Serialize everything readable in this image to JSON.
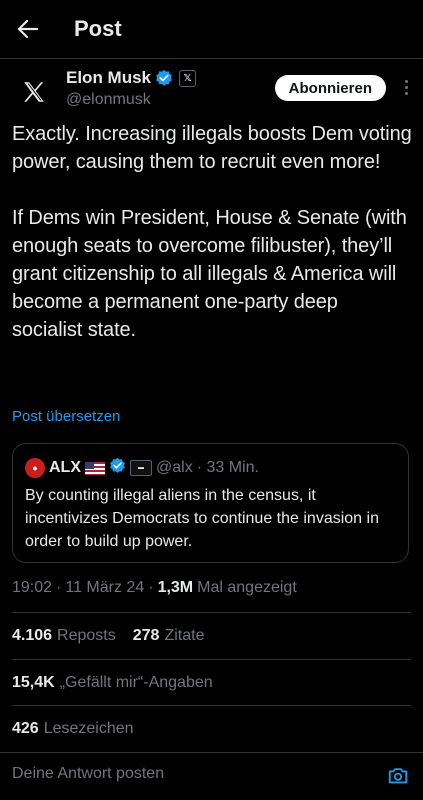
{
  "header": {
    "title": "Post"
  },
  "author": {
    "name": "Elon Musk",
    "handle": "@elonmusk",
    "subscribe_label": "Abonnieren",
    "affiliate_badge": "𝕏"
  },
  "post": {
    "text": "Exactly. Increasing illegals boosts Dem voting power, causing them to recruit even more!\n\nIf Dems win President, House & Senate (with enough seats to overcome filibuster), they’ll grant citizenship to all illegals & America will become a permanent one-party deep socialist state.",
    "translate_label": "Post übersetzen"
  },
  "quote": {
    "name": "ALX",
    "handle": "@alx",
    "time": "· 33 Min.",
    "text": "By counting illegal aliens in the census, it incentivizes Democrats to continue the invasion in order to build up power."
  },
  "meta": {
    "time": "19:02",
    "sep1": "·",
    "date": "11 März 24",
    "sep2": "·",
    "views": "1,3M",
    "views_label": "Mal angezeigt"
  },
  "stats": {
    "reposts": "4.106",
    "reposts_label": "Reposts",
    "quotes": "278",
    "quotes_label": "Zitate",
    "likes": "15,4K",
    "likes_label": "„Gefällt mir“-Angaben",
    "bookmarks": "426",
    "bookmarks_label": "Lesezeichen"
  },
  "reply": {
    "placeholder": "Deine Antwort posten"
  },
  "colors": {
    "accent": "#1d9bf0",
    "background": "#000000",
    "muted": "#71767b",
    "divider": "#2f3336"
  }
}
